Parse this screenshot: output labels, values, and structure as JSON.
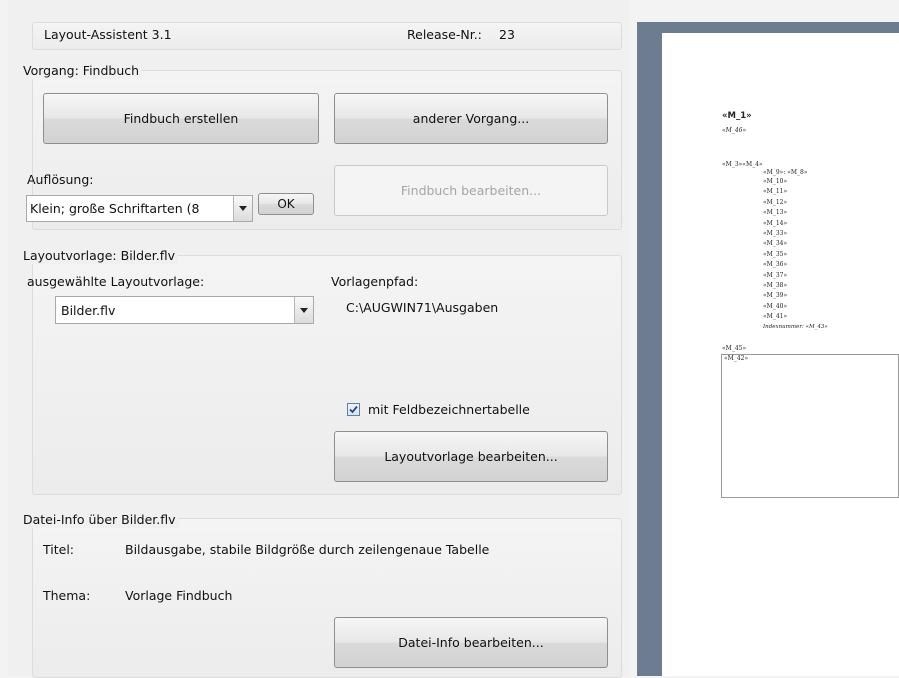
{
  "header": {
    "app_title": "Layout-Assistent 3.1",
    "release_label": "Release-Nr.:",
    "release_value": "23"
  },
  "vorgang": {
    "title": "Vorgang: Findbuch",
    "create_button": "Findbuch erstellen",
    "other_button": "anderer Vorgang...",
    "resolution_label": "Auflösung:",
    "resolution_value": "Klein; große Schriftarten (8",
    "ok_button": "OK",
    "edit_button": "Findbuch bearbeiten..."
  },
  "layout": {
    "title": "Layoutvorlage:  Bilder.flv",
    "selected_label": "ausgewählte Layoutvorlage:",
    "selected_value": "Bilder.flv",
    "path_label": "Vorlagenpfad:",
    "path_value": "C:\\AUGWIN71\\Ausgaben",
    "checkbox_label": "mit Feldbezeichnertabelle",
    "checkbox_checked": true,
    "edit_button": "Layoutvorlage bearbeiten..."
  },
  "fileinfo": {
    "title": "Datei-Info über Bilder.flv",
    "titel_label": "Titel:",
    "titel_value": "Bildausgabe, stabile Bildgröße durch zeilengenaue Tabelle",
    "thema_label": "Thema:",
    "thema_value": "Vorlage Findbuch",
    "edit_button": "Datei-Info bearbeiten..."
  },
  "preview": {
    "heading": "«M_1»",
    "subheading": "«M_46»",
    "row_head": "«M_3»«M_4»",
    "row_second": "«M_9»: «M_8»",
    "fields": [
      "«M_10»",
      "«M_11»",
      "«M_12»",
      "«M_13»",
      "«M_14»",
      "«M_33»",
      "«M_34»",
      "«M_35»",
      "«M_36»",
      "«M_37»",
      "«M_38»",
      "«M_39»",
      "«M_40»",
      "«M_41»"
    ],
    "index_line": "Indexnummer: «M_43»",
    "footer_1": "«M_45»",
    "footer_2": "«M_42»"
  }
}
